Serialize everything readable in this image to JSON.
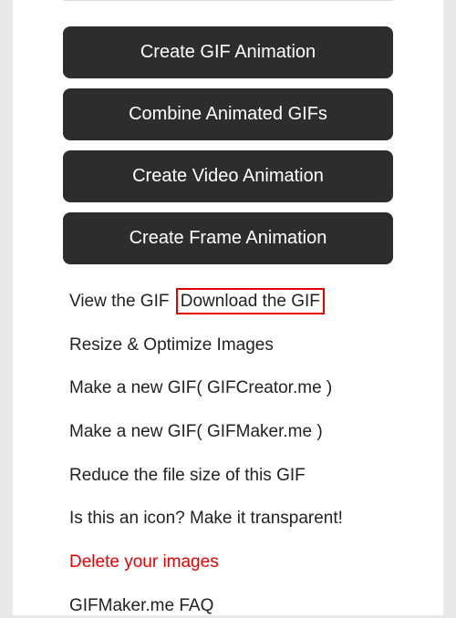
{
  "buttons": {
    "create_gif": "Create GIF Animation",
    "combine_gifs": "Combine Animated GIFs",
    "create_video": "Create Video Animation",
    "create_frame": "Create Frame Animation"
  },
  "links": {
    "view_gif": "View the GIF",
    "download_gif": "Download the GIF",
    "resize_optimize": "Resize & Optimize Images",
    "make_new_creator": "Make a new GIF( GIFCreator.me )",
    "make_new_maker": "Make a new GIF( GIFMaker.me )",
    "reduce_size": "Reduce the file size of this GIF",
    "make_transparent": "Is this an icon? Make it transparent!",
    "delete_images": "Delete your images",
    "faq": "GIFMaker.me FAQ"
  }
}
